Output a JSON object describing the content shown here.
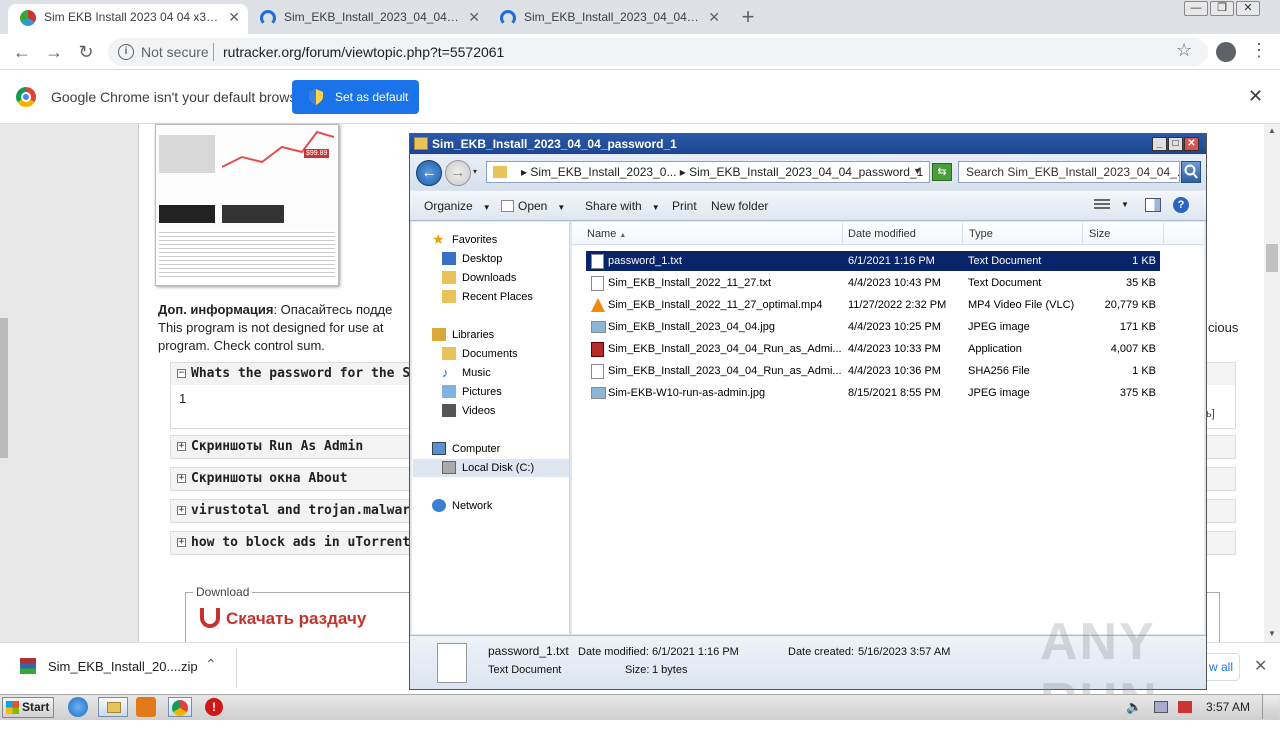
{
  "browser": {
    "tabs": [
      {
        "label": "Sim EKB Install 2023 04 04 x32 [2023"
      },
      {
        "label": "Sim_EKB_Install_2023_04_04_password"
      },
      {
        "label": "Sim_EKB_Install_2023_04_04_password"
      }
    ],
    "new_tab": "+",
    "window_controls": {
      "minimize": "—",
      "restore": "❐",
      "close": "✕"
    },
    "nav": {
      "back": "←",
      "forward": "→",
      "reload": "↻"
    },
    "omnibox": {
      "security": "Not secure",
      "url": "rutracker.org/forum/viewtopic.php?t=5572061"
    },
    "infobar": {
      "message": "Google Chrome isn't your default browser",
      "button": "Set as default",
      "close": "✕"
    },
    "icons": {
      "star": "☆",
      "menu": "⋮"
    }
  },
  "webpage": {
    "dop_label": "Доп. информация",
    "dop_text": ": Опасайтесь подде",
    "line2_left": "This program is not designed for use at",
    "line2_right": "cious",
    "line3": "program. Check control sum.",
    "spoilers": [
      {
        "title": "Whats the password for the Sim_E",
        "icon": "−"
      },
      {
        "title": "Скриншоты Run As Admin",
        "icon": "+"
      },
      {
        "title": "Скриншоты окна About",
        "icon": "+"
      },
      {
        "title": "virustotal and trojan.malware.300",
        "icon": "+"
      },
      {
        "title": "how to block ads in uTorrent / ка",
        "icon": "+"
      }
    ],
    "spoiler_body": "1",
    "side_text": "ь]",
    "download_legend": "Download",
    "download_link": "Скачать раздачу",
    "thumb_price": "$99.89"
  },
  "shelf": {
    "file": "Sim_EKB_Install_20....zip",
    "chevron": "⌃",
    "show_all": "w all",
    "close": "✕"
  },
  "explorer": {
    "title": "Sim_EKB_Install_2023_04_04_password_1",
    "window_controls": {
      "minimize": "_",
      "maximize": "□",
      "close": "✕"
    },
    "address": "▸ Sim_EKB_Install_2023_0... ▸ Sim_EKB_Install_2023_04_04_password_1",
    "search_placeholder": "Search Sim_EKB_Install_2023_04_04_...",
    "commands": [
      "Organize",
      "Open",
      "Share with",
      "Print",
      "New folder"
    ],
    "nav": {
      "favorites": "Favorites",
      "desktop": "Desktop",
      "downloads": "Downloads",
      "recent": "Recent Places",
      "libraries": "Libraries",
      "documents": "Documents",
      "music": "Music",
      "pictures": "Pictures",
      "videos": "Videos",
      "computer": "Computer",
      "localdisk": "Local Disk (C:)",
      "network": "Network"
    },
    "columns": [
      "Name",
      "Date modified",
      "Type",
      "Size"
    ],
    "files": [
      {
        "name": "password_1.txt",
        "date": "6/1/2021 1:16 PM",
        "type": "Text Document",
        "size": "1 KB"
      },
      {
        "name": "Sim_EKB_Install_2022_11_27.txt",
        "date": "4/4/2023 10:43 PM",
        "type": "Text Document",
        "size": "35 KB"
      },
      {
        "name": "Sim_EKB_Install_2022_11_27_optimal.mp4",
        "date": "11/27/2022 2:32 PM",
        "type": "MP4 Video File (VLC)",
        "size": "20,779 KB"
      },
      {
        "name": "Sim_EKB_Install_2023_04_04.jpg",
        "date": "4/4/2023 10:25 PM",
        "type": "JPEG image",
        "size": "171 KB"
      },
      {
        "name": "Sim_EKB_Install_2023_04_04_Run_as_Admi...",
        "date": "4/4/2023 10:33 PM",
        "type": "Application",
        "size": "4,007 KB"
      },
      {
        "name": "Sim_EKB_Install_2023_04_04_Run_as_Admi...",
        "date": "4/4/2023 10:36 PM",
        "type": "SHA256 File",
        "size": "1 KB"
      },
      {
        "name": "Sim-EKB-W10-run-as-admin.jpg",
        "date": "8/15/2021 8:55 PM",
        "type": "JPEG image",
        "size": "375 KB"
      }
    ],
    "details": {
      "name": "password_1.txt",
      "type": "Text Document",
      "modified_label": "Date modified:",
      "modified": "6/1/2021 1:16 PM",
      "created_label": "Date created:",
      "created": "5/16/2023 3:57 AM",
      "size_label": "Size:",
      "size": "1 bytes"
    }
  },
  "taskbar": {
    "start": "Start",
    "clock": "3:57 AM"
  },
  "watermark": "ANY RUN"
}
